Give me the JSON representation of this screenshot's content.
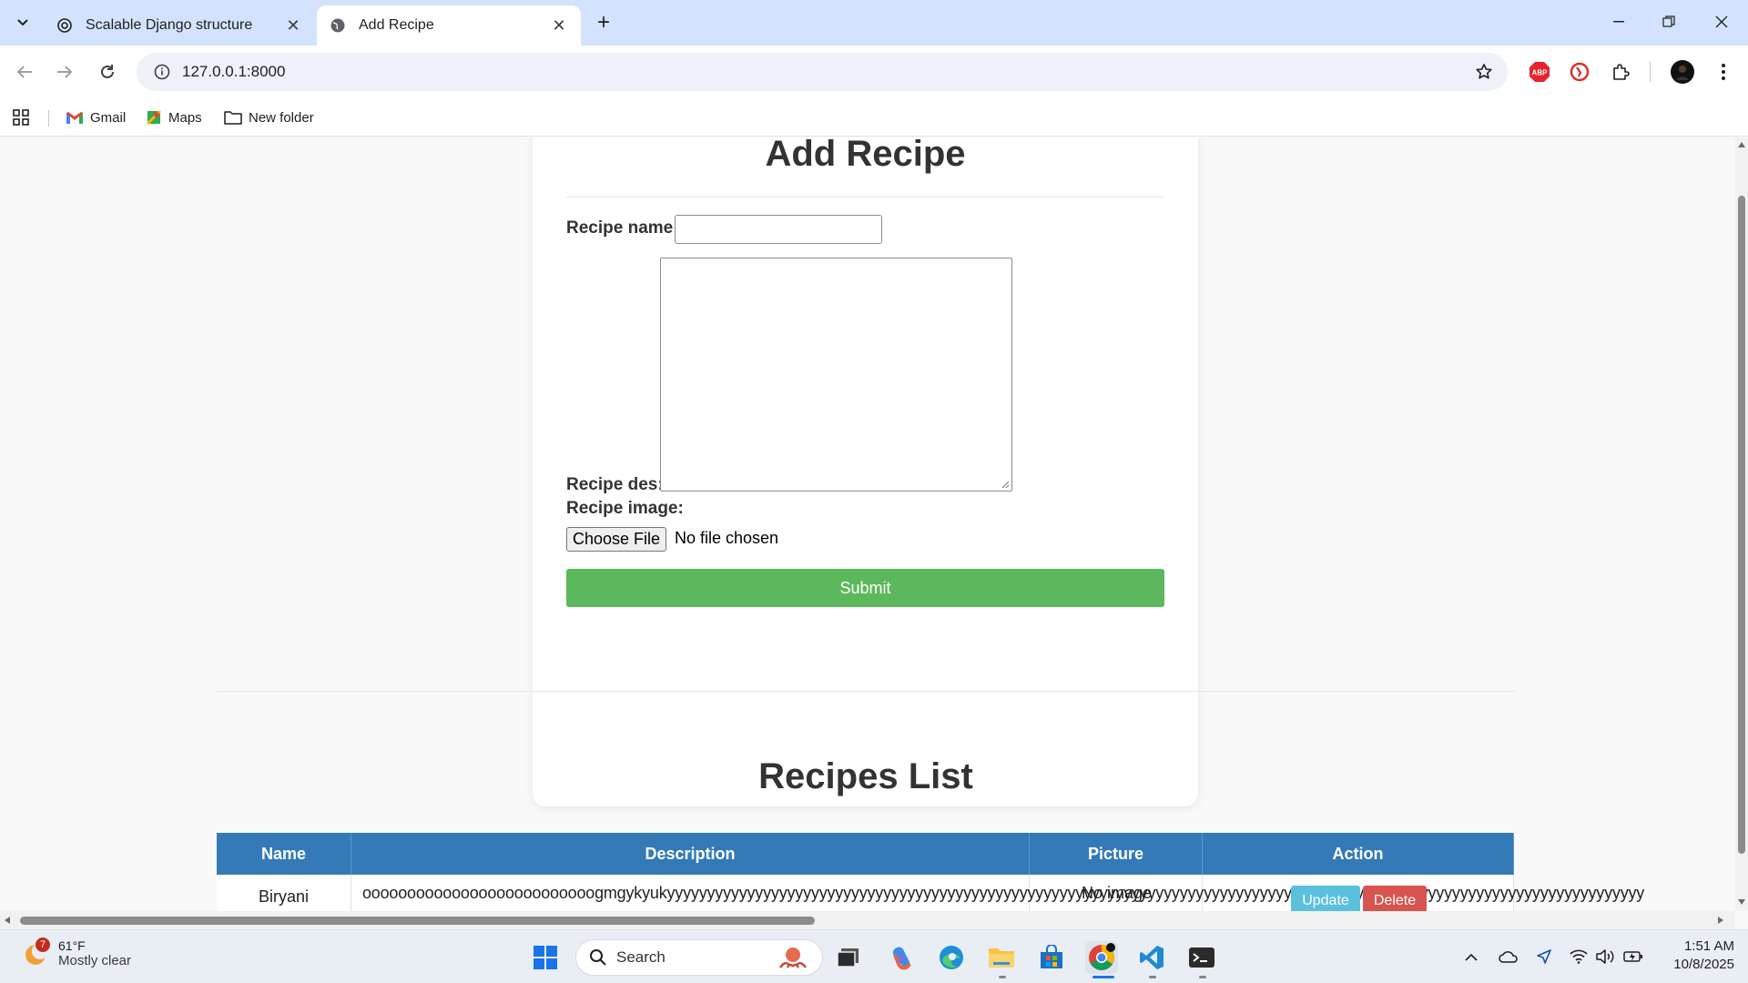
{
  "browser": {
    "tabs": [
      {
        "title": "Scalable Django structure",
        "active": false
      },
      {
        "title": "Add Recipe",
        "active": true
      }
    ],
    "url": "127.0.0.1:8000",
    "bookmarks": [
      {
        "label": "Gmail"
      },
      {
        "label": "Maps"
      },
      {
        "label": "New folder"
      }
    ],
    "extensions": [
      "adblock-plus-icon",
      "tab-suspender-icon",
      "extensions-icon"
    ]
  },
  "form": {
    "heading": "Add Recipe",
    "name_label": "Recipe name:",
    "name_value": "",
    "desc_label": "Recipe des:",
    "desc_value": "",
    "image_label": "Recipe image:",
    "file_button": "Choose File",
    "file_status": "No file chosen",
    "submit_label": "Submit"
  },
  "list": {
    "heading": "Recipes List",
    "columns": [
      "Name",
      "Description",
      "Picture",
      "Action"
    ],
    "rows": [
      {
        "name": "Biryani",
        "description": "oooooooooooooooooooooooooogmgykyukyyyyyyyyyyyyyyyyyyyyyyyyyyyyyyyyyyyyyyyyyyyyyyyyyyyyyyyyyyyyyyyyyyyyyyyyyyyyyyyyyyyyyyyyyyyyyyyyyyyyyyyyyyyyyyyyyyyyyyyyyy",
        "picture": "No image",
        "update_label": "Update",
        "delete_label": "Delete"
      }
    ]
  },
  "taskbar": {
    "weather_badge": "7",
    "temperature": "61°F",
    "condition": "Mostly clear",
    "search_label": "Search",
    "time": "1:51 AM",
    "date": "10/8/2025"
  },
  "colors": {
    "submit": "#5cb85c",
    "table_header": "#337ab7",
    "update": "#5bc0de",
    "delete": "#d9534f",
    "tab_strip": "#d3e3fd"
  }
}
